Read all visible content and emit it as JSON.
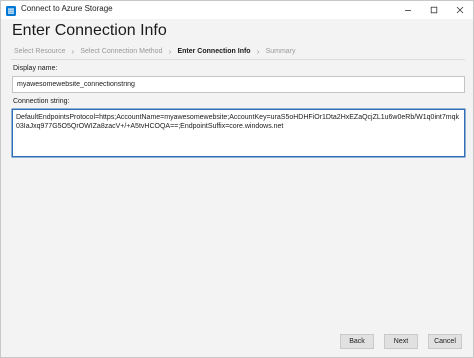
{
  "window": {
    "title": "Connect to Azure Storage",
    "accent_color": "#0078d4"
  },
  "page": {
    "heading": "Enter Connection Info"
  },
  "steps": [
    {
      "label": "Select Resource",
      "active": false
    },
    {
      "label": "Select Connection Method",
      "active": false
    },
    {
      "label": "Enter Connection Info",
      "active": true
    },
    {
      "label": "Summary",
      "active": false
    }
  ],
  "form": {
    "display_name_label": "Display name:",
    "display_name_value": "myawesomewebsite_connectionstring",
    "connection_string_label": "Connection string:",
    "connection_string_value": "DefaultEndpointsProtocol=https;AccountName=myawesomewebsite;AccountKey=uraS5oHDHFiOr1Dta2HxEZaQcjZL1u6w0eRb/W1q0int7mqk03IaJxq977G5O5QrOWIZa8zacV+/+A5tvHCOQA==;EndpointSuffix=core.windows.net"
  },
  "footer": {
    "back_label": "Back",
    "next_label": "Next",
    "cancel_label": "Cancel"
  }
}
